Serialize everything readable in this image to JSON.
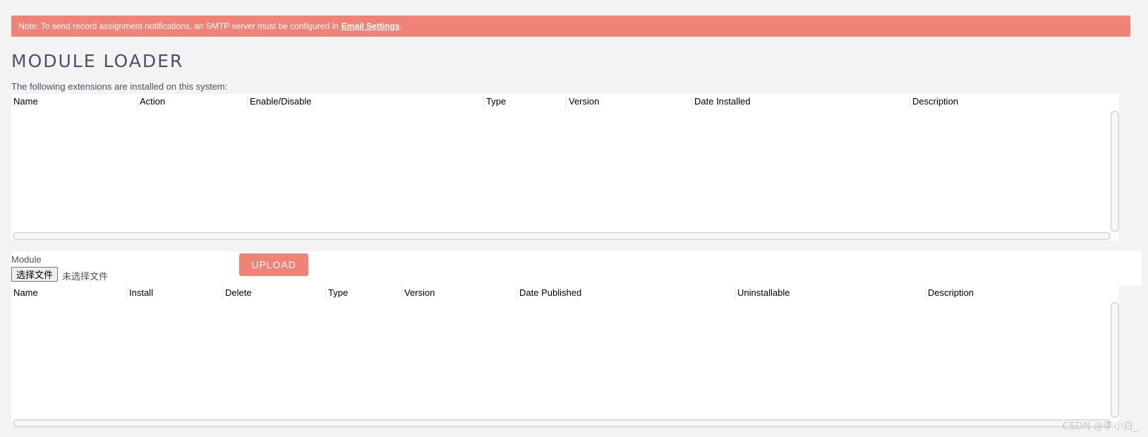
{
  "notice": {
    "text": "Note: To send record assignment notifications, an SMTP server must be configured in",
    "link_text": "Email Settings",
    "suffix": "."
  },
  "page_title": "MODULE LOADER",
  "installed": {
    "intro": "The following extensions are installed on this system:",
    "columns": [
      "Name",
      "Action",
      "Enable/Disable",
      "Type",
      "Version",
      "Date Installed",
      "Description"
    ]
  },
  "upload": {
    "module_label": "Module",
    "file_button": "选择文件",
    "file_status": "未选择文件",
    "upload_button": "UPLOAD"
  },
  "published": {
    "columns": [
      "Name",
      "Install",
      "Delete",
      "Type",
      "Version",
      "Date Published",
      "Uninstallable",
      "Description"
    ]
  },
  "watermark": "CSDN @李小白_",
  "colors": {
    "accent": "#f08377",
    "background": "#f3f3f3",
    "text": "#534d64"
  }
}
